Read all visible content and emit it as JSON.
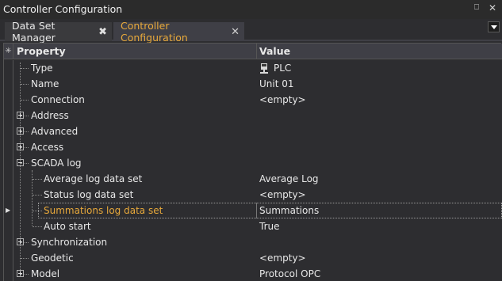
{
  "window": {
    "title": "Controller Configuration",
    "pin_glyph": "⎕",
    "close_glyph": "✕"
  },
  "tabs": [
    {
      "label": "Data Set Manager",
      "close": "✖"
    },
    {
      "label": "Controller Configuration",
      "close": "✕"
    }
  ],
  "grid": {
    "corner_glyph": "✳",
    "headers": {
      "property": "Property",
      "value": "Value"
    },
    "rows": [
      {
        "label": "Type",
        "value": "PLC",
        "icon": "plc-icon"
      },
      {
        "label": "Name",
        "value": "Unit 01"
      },
      {
        "label": "Connection",
        "value": "<empty>"
      },
      {
        "label": "Address",
        "value": "",
        "expander": "plus"
      },
      {
        "label": "Advanced",
        "value": "",
        "expander": "plus"
      },
      {
        "label": "Access",
        "value": "",
        "expander": "plus"
      },
      {
        "label": "SCADA log",
        "value": "",
        "expander": "minus"
      },
      {
        "label": "Average log data set",
        "value": "Average Log"
      },
      {
        "label": "Status log data set",
        "value": "<empty>"
      },
      {
        "label": "Summations log data set",
        "value": "Summations",
        "selected": true
      },
      {
        "label": "Auto start",
        "value": "True"
      },
      {
        "label": "Synchronization",
        "value": "",
        "expander": "plus"
      },
      {
        "label": "Geodetic",
        "value": "<empty>"
      },
      {
        "label": "Model",
        "value": "Protocol OPC",
        "expander": "plus"
      }
    ]
  },
  "colors": {
    "accent": "#e8a93b",
    "background": "#2d2d30",
    "header": "#3f3f46"
  }
}
